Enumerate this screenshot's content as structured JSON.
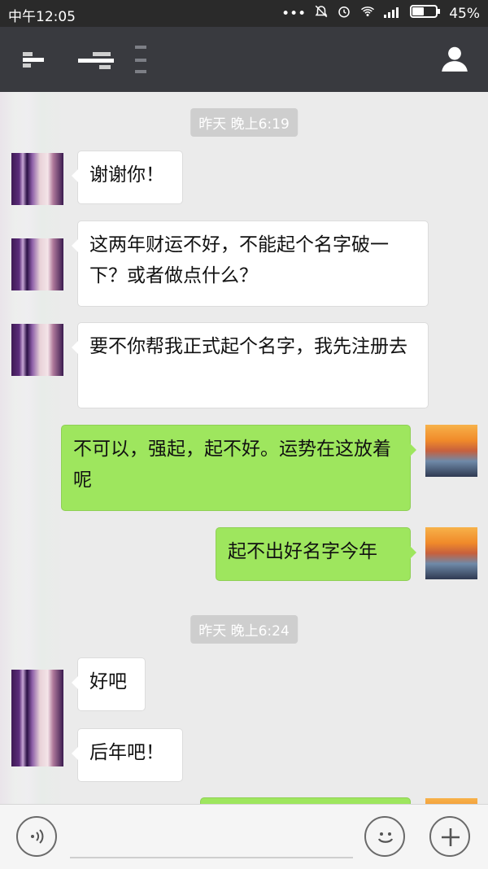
{
  "status_bar": {
    "carrier_time": "中午12:05",
    "battery_text": "45%"
  },
  "navbar": {},
  "chat": {
    "timestamps": [
      "昨天 晚上6:19",
      "昨天 晚上6:24"
    ],
    "messages": [
      {
        "side": "in",
        "text": "谢谢你！"
      },
      {
        "side": "in",
        "text": "这两年财运不好，不能起个名字破一下？或者做点什么？"
      },
      {
        "side": "in",
        "text": "要不你帮我正式起个名字，我先注册去"
      },
      {
        "side": "out",
        "text": "不可以，强起，起不好。运势在这放着呢"
      },
      {
        "side": "out",
        "text": "起不出好名字今年"
      },
      {
        "side": "in",
        "text": "好吧"
      },
      {
        "side": "in",
        "text": "后年吧！"
      },
      {
        "side": "out",
        "text": ""
      }
    ]
  },
  "bottom_bar": {}
}
